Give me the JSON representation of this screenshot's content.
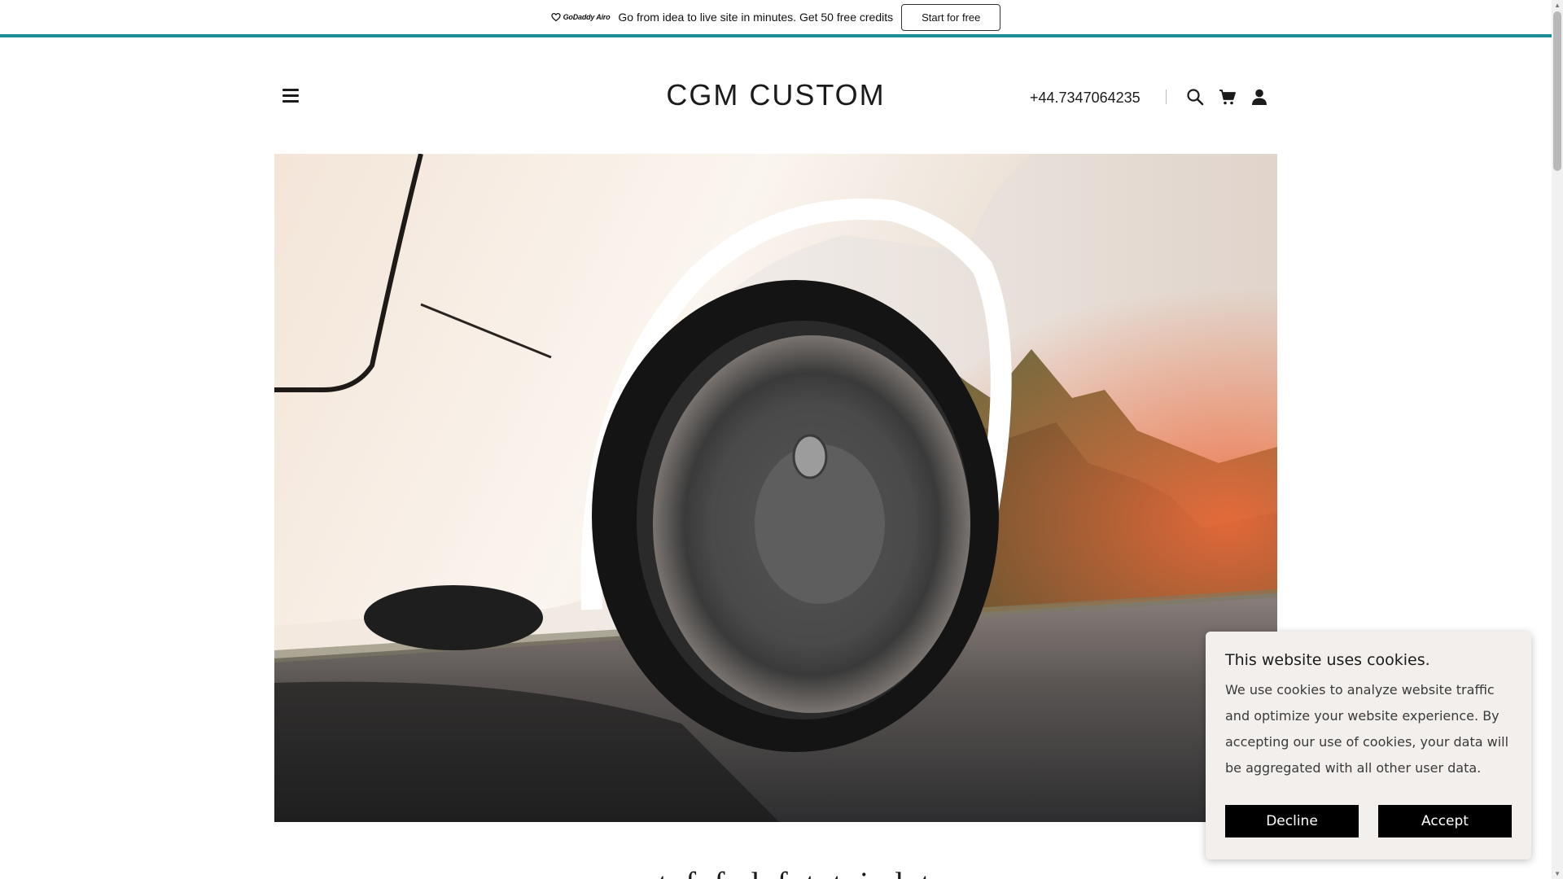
{
  "promo": {
    "logo_text": "GoDaddy Airo",
    "message": "Go from idea to live site in minutes. Get 50 free credits",
    "cta_label": "Start for free",
    "accent_color": "#1c8c96"
  },
  "header": {
    "menu_icon": "hamburger-menu-icon",
    "site_title": "CGM CUSTOM",
    "phone": "+44.7347064235",
    "icons": [
      "search-icon",
      "cart-icon",
      "account-icon"
    ]
  },
  "hero": {
    "image_alt": "Close-up of a white car wheel driving on a tree-lined road at sunset"
  },
  "section": {
    "heading_partial": "w   t  f   f     d  f   t   t  i  d  t"
  },
  "cookie": {
    "title": "This website uses cookies.",
    "body": "We use cookies to analyze website traffic and optimize your website experience. By accepting our use of cookies, your data will be aggregated with all other user data.",
    "decline_label": "Decline",
    "accept_label": "Accept",
    "button_color": "#000000"
  }
}
